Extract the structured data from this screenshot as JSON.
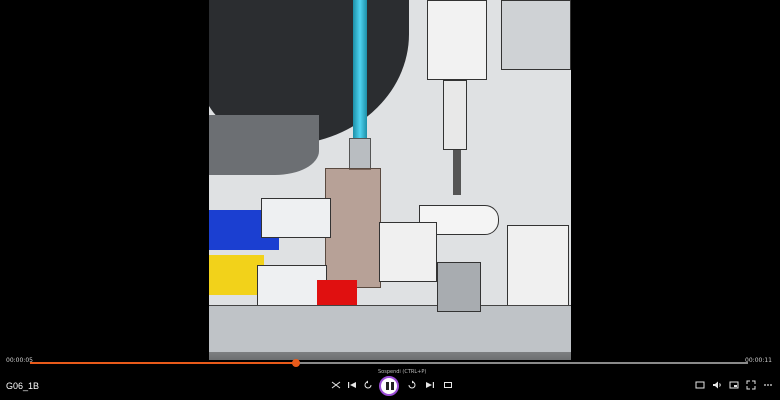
{
  "player": {
    "title": "G06_1B",
    "time_elapsed": "00:00:05",
    "time_total": "00:00:11",
    "progress": 0.37,
    "tooltip": "Sospendi (CTRL+P)",
    "accent_color": "#e85a1a",
    "focus_ring_color": "#9b4dd6"
  },
  "controls": {
    "left": [
      "shuffle-icon",
      "previous-icon",
      "rewind-10-icon"
    ],
    "center": "pause-icon",
    "right_of_center": [
      "forward-30-icon",
      "next-icon",
      "repeat-icon"
    ],
    "far_right": [
      "cast-icon",
      "volume-icon",
      "picture-in-picture-icon",
      "fullscreen-icon",
      "more-icon"
    ]
  }
}
